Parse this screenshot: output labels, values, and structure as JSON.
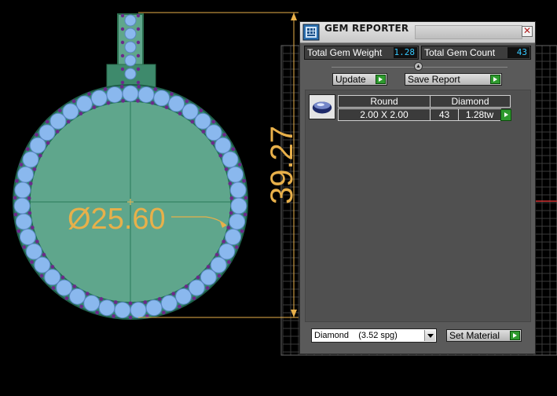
{
  "viewport": {
    "diameter_label": "Ø25.60",
    "height_label": "39.27",
    "colors": {
      "metal": "#5fa68c",
      "metal_edge": "#2a6e4e",
      "gem": "#8ab8ee",
      "prong": "#6b2a8a",
      "dimension": "#e8b04a",
      "grid": "#3a3a3a",
      "axis": "#d03030"
    }
  },
  "panel": {
    "title": "GEM REPORTER",
    "close_icon": "close-icon",
    "stats": {
      "total_weight_label": "Total Gem Weight",
      "total_weight_value": "1.28",
      "total_count_label": "Total Gem Count",
      "total_count_value": "43"
    },
    "buttons": {
      "update": "Update",
      "save_report": "Save Report",
      "set_material": "Set Material"
    },
    "report": {
      "columns": {
        "shape": "Round",
        "material": "Diamond"
      },
      "rows": [
        {
          "size": "2.00 X 2.00",
          "count": "43",
          "weight": "1.28tw"
        }
      ]
    },
    "material_select": {
      "selected": "Diamond    (3.52 spg)"
    }
  }
}
